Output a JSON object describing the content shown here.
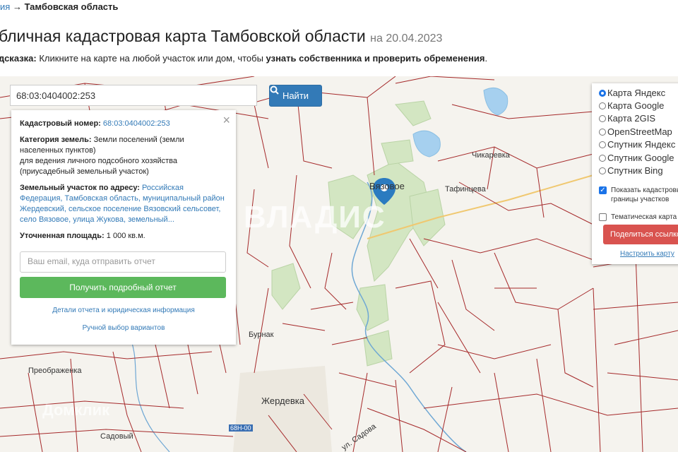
{
  "breadcrumb": {
    "prev": "ия",
    "arrow": "→",
    "current": "Тамбовская область"
  },
  "page": {
    "title": "бличная кадастровая карта Тамбовской области",
    "date": "на 20.04.2023",
    "hint_label": "дсказка:",
    "hint_text": "Кликните на карте на любой участок или дом, чтобы",
    "hint_bold": "узнать собственника и проверить обременения",
    "hint_end": "."
  },
  "search": {
    "value": "68:03:0404002:253",
    "button_label": "Найти",
    "button_icon": "search-icon"
  },
  "parcel_card": {
    "cadastral_label": "Кадастровый номер:",
    "cadastral_value": "68:03:0404002:253",
    "category_label": "Категория земель:",
    "category_value": "Земли поселений (земли населенных пунктов)",
    "use_value": "для ведения личного подсобного хозяйства (приусадебный земельный участок)",
    "address_label": "Земельный участок по адресу:",
    "address_value": "Российская Федерация, Тамбовская область, муниципальный район Жердевский, сельское поселение Вязовский сельсовет, село Вязовое, улица Жукова, земельный...",
    "area_label": "Уточненная площадь:",
    "area_value": "1 000 кв.м.",
    "email_placeholder": "Ваш email, куда отправить отчет",
    "report_button": "Получить подробный отчет",
    "details_link": "Детали отчета и юридическая информация",
    "manual_link": "Ручной выбор вариантов"
  },
  "layers": {
    "options": [
      "Карта Яндекс",
      "Карта Google",
      "Карта 2GIS",
      "OpenStreetMap",
      "Спутник Яндекс",
      "Спутник Google",
      "Спутник Bing"
    ],
    "selected": "Карта Яндекс",
    "show_boundaries": "Показать кадастровые границы участков",
    "thematic_map": "Тематическая карта",
    "share_button": "Поделиться ссылкой",
    "configure_link": "Настроить карту"
  },
  "map": {
    "places": [
      "Вязовое",
      "Тафинцева",
      "Чикаревка",
      "Бурнак",
      "Преображенка",
      "Жердевка",
      "Садовый",
      "ул. Садова"
    ],
    "road_badge": "68Н-00",
    "watermark": "ВЛАДИС",
    "watermark2": "Домклик"
  },
  "colors": {
    "boundary": "#a5292a",
    "search_button": "#337ab7",
    "report_button": "#5cb85c",
    "share_button": "#d9534f",
    "forest": "#d3e6c2",
    "water": "#a6d0ef"
  }
}
